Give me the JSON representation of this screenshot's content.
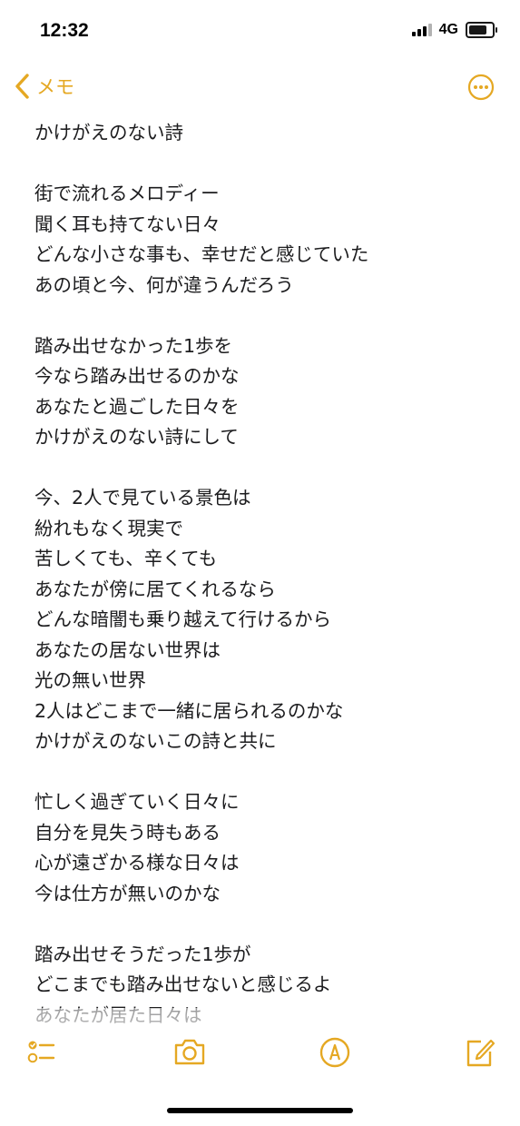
{
  "status": {
    "time": "12:32",
    "network": "4G",
    "battery_level": 0.8
  },
  "nav": {
    "back_label": "メモ",
    "back_icon": "chevron-left-icon",
    "more_icon": "ellipsis-circle-icon"
  },
  "accent_color": "#e5a823",
  "note": {
    "lines": [
      "かけがえのない詩",
      "",
      "街で流れるメロディー",
      "聞く耳も持てない日々",
      "どんな小さな事も、幸せだと感じていた",
      "あの頃と今、何が違うんだろう",
      "",
      "踏み出せなかった1歩を",
      "今なら踏み出せるのかな",
      "あなたと過ごした日々を",
      "かけがえのない詩にして",
      "",
      "今、2人で見ている景色は",
      "紛れもなく現実で",
      "苦しくても、辛くても",
      "あなたが傍に居てくれるなら",
      "どんな暗闇も乗り越えて行けるから",
      "あなたの居ない世界は",
      "光の無い世界",
      "2人はどこまで一緒に居られるのかな",
      "かけがえのないこの詩と共に",
      "",
      "忙しく過ぎていく日々に",
      "自分を見失う時もある",
      "心が遠ざかる様な日々は",
      "今は仕方が無いのかな",
      "",
      "踏み出せそうだった1歩が",
      "どこまでも踏み出せないと感じるよ",
      "あなたが居た日々は"
    ]
  },
  "toolbar": {
    "checklist_icon": "checklist-icon",
    "camera_icon": "camera-icon",
    "markup_icon": "markup-pen-icon",
    "compose_icon": "compose-icon"
  }
}
